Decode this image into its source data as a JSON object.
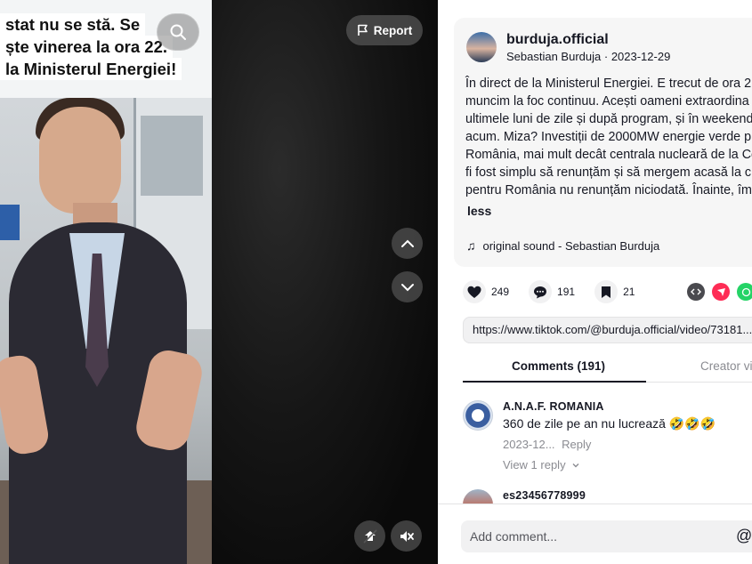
{
  "video": {
    "caption_lines": [
      "stat nu se stă. Se",
      "ște vinerea la ora 22.",
      "la Ministerul Energiei!"
    ],
    "report_label": "Report",
    "icons": {
      "search": "search-icon",
      "report": "flag-icon",
      "prev": "chevron-up-icon",
      "next": "chevron-down-icon",
      "pip": "floating-player-icon",
      "mute": "speaker-muted-icon"
    }
  },
  "post": {
    "author_handle": "burduja.official",
    "author_name": "Sebastian Burduja",
    "date": "2023-12-29",
    "description_lines": [
      "În direct de la Ministerul Energiei. E trecut de ora 2",
      "muncim la foc continuu. Acești oameni extraordina",
      "ultimele luni de zile și după program, și în weekend",
      "acum. Miza? Investiții de 2000MW energie verde p",
      "România, mai mult decât centrala nucleară de la Ce",
      "fi fost simplu să renunțăm și să mergem acasă la c",
      "pentru România nu renunțăm niciodată. Înainte, îm"
    ],
    "less_label": "less",
    "sound": "original sound - Sebastian Burduja"
  },
  "actions": {
    "likes": "249",
    "comments": "191",
    "saves": "21",
    "share_icons": [
      "embed-icon",
      "send-icon",
      "whatsapp-icon"
    ],
    "colors": {
      "embed": "#4a4a4f",
      "send": "#fe2c55",
      "whatsapp": "#25d366"
    }
  },
  "url": "https://www.tiktok.com/@burduja.official/video/73181...",
  "tabs": {
    "comments": "Comments (191)",
    "creator": "Creator vid"
  },
  "comments": [
    {
      "user": "A.N.A.F. ROMANIA",
      "text": "360 de zile pe an nu lucrează 🤣🤣🤣",
      "date": "2023-12...",
      "reply_label": "Reply",
      "view_replies": "View 1 reply"
    },
    {
      "user": "es23456778999"
    }
  ],
  "composer": {
    "placeholder": "Add comment...",
    "mention_icon": "@"
  }
}
